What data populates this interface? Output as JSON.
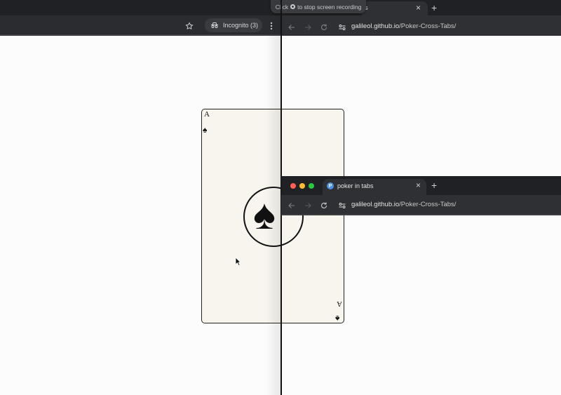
{
  "recording_banner": {
    "prefix": "Click",
    "suffix": "to stop screen recording"
  },
  "left_window": {
    "incognito_label": "Incognito (3)",
    "icons": [
      "star-icon",
      "incognito-icon",
      "kebab-menu-icon"
    ]
  },
  "right_window": {
    "tab_title_fragment": "s",
    "address": {
      "domain": "galileol.github.io",
      "path": "/Poker-Cross-Tabs/"
    },
    "new_tab_symbol": "+",
    "close_symbol": "×"
  },
  "second_window": {
    "tab_title": "poker in tabs",
    "favicon_letter": "P",
    "address": {
      "domain": "galileol.github.io",
      "path": "/Poker-Cross-Tabs/"
    },
    "new_tab_symbol": "+",
    "close_symbol": "×"
  },
  "card": {
    "rank": "A",
    "suit": "♠",
    "rank_bottom": "A"
  }
}
